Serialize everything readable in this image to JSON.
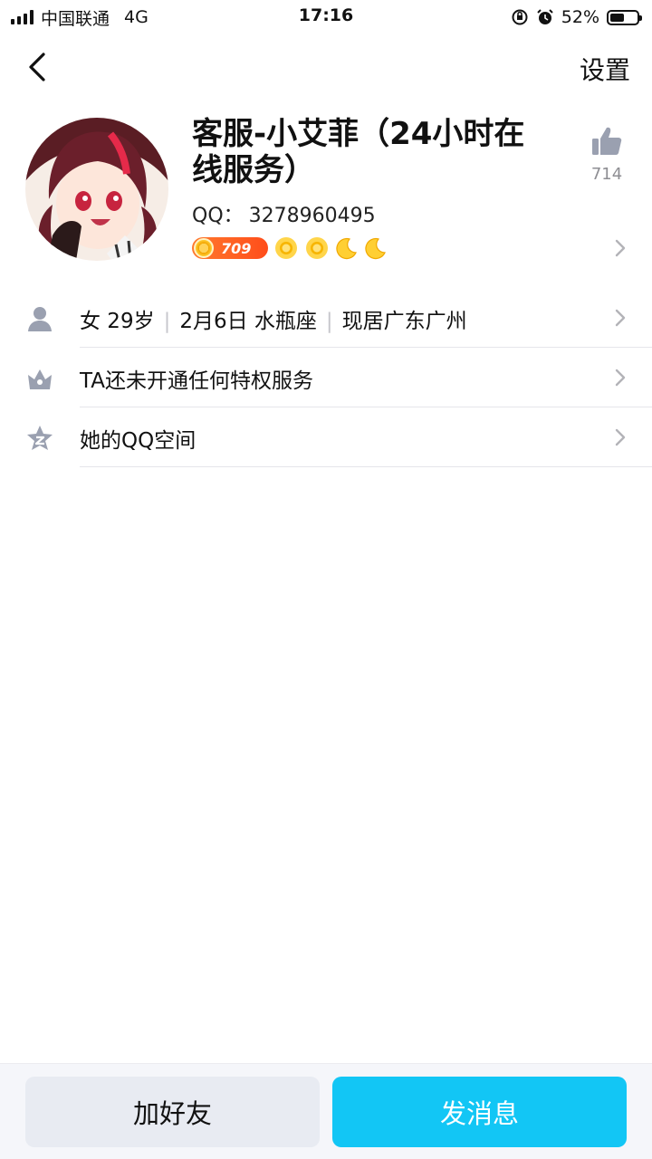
{
  "status_bar": {
    "carrier": "中国联通",
    "network": "4G",
    "time": "17:16",
    "battery_text": "52%",
    "battery_level": 0.52
  },
  "nav": {
    "back_icon": "chevron-left-icon",
    "settings_label": "设置"
  },
  "profile": {
    "name": "客服-小艾菲（24小时在线服务）",
    "qq_label": "QQ：",
    "qq_number": "3278960495",
    "level": "709",
    "level_icons": [
      "sun-icon",
      "sun-icon",
      "moon-icon",
      "moon-icon"
    ],
    "likes": "714"
  },
  "info_rows": [
    {
      "icon": "person-icon",
      "parts": [
        "女 29岁",
        "2月6日 水瓶座",
        "现居广东广州"
      ]
    },
    {
      "icon": "crown-icon",
      "text": "TA还未开通任何特权服务"
    },
    {
      "icon": "qzone-star-icon",
      "text": "她的QQ空间"
    }
  ],
  "actions": {
    "add_friend": "加好友",
    "send_message": "发消息"
  },
  "colors": {
    "primary": "#12c6f5",
    "secondary_button": "#e8ebf2",
    "icon_gray": "#9aa0b0",
    "level_orange": "#ff5a1f"
  }
}
